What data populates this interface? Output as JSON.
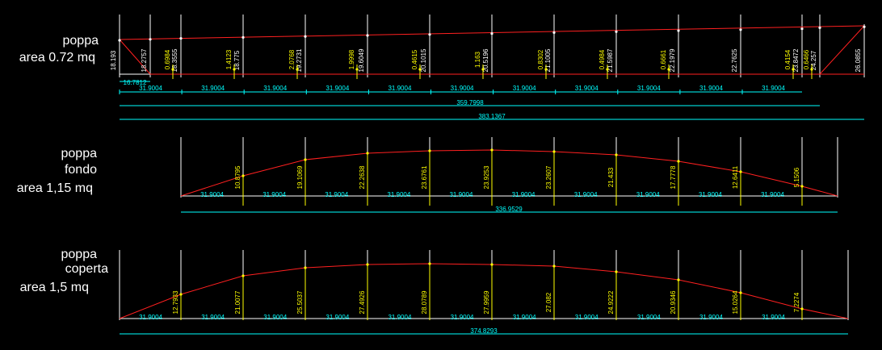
{
  "panels": [
    {
      "labels": [
        "poppa",
        "area 0.72 mq"
      ],
      "spacing_label": "31.9004",
      "spacing_count": 11,
      "total_labels": [
        "16.7812",
        "359.7998",
        "383.1367"
      ],
      "heights": [
        "18.193",
        "18.2757",
        "18.3555",
        "18.775",
        "19.2731",
        "19.6049",
        "20.1015",
        "20.5196",
        "21.1005",
        "21.5987",
        "22.1979",
        "22.7625",
        "23.8472",
        "24.257",
        "26.0855"
      ],
      "offsets": [
        "0.6984",
        "1.4123",
        "2.0768",
        "1.9998",
        "0.4615",
        "1.163",
        "0.8302",
        "0.4984",
        "0.6661",
        "0.4154",
        "0.6466"
      ]
    },
    {
      "labels": [
        "poppa",
        "fondo",
        "area 1,15 mq"
      ],
      "spacing_label": "31.9004",
      "spacing_count": 10,
      "total_labels": [
        "336.9529"
      ],
      "heights": [
        "10.8795",
        "19.1069",
        "22.2638",
        "23.6761",
        "23.9253",
        "23.2607",
        "21.433",
        "17.7778",
        "12.6411",
        "5.1506"
      ]
    },
    {
      "labels": [
        "poppa",
        "coperta",
        "area 1,5 mq"
      ],
      "spacing_label": "31.9004",
      "spacing_count": 11,
      "total_labels": [
        "374.8293"
      ],
      "heights": [
        "12.7933",
        "21.0077",
        "25.5037",
        "27.4926",
        "28.0789",
        "27.9959",
        "27.082",
        "24.9222",
        "20.9346",
        "15.0264",
        "7.2274"
      ]
    }
  ],
  "colors": {
    "curve": "#ff2020",
    "dim": "#00ffff",
    "value": "#ffff00",
    "line": "#ffffff"
  }
}
